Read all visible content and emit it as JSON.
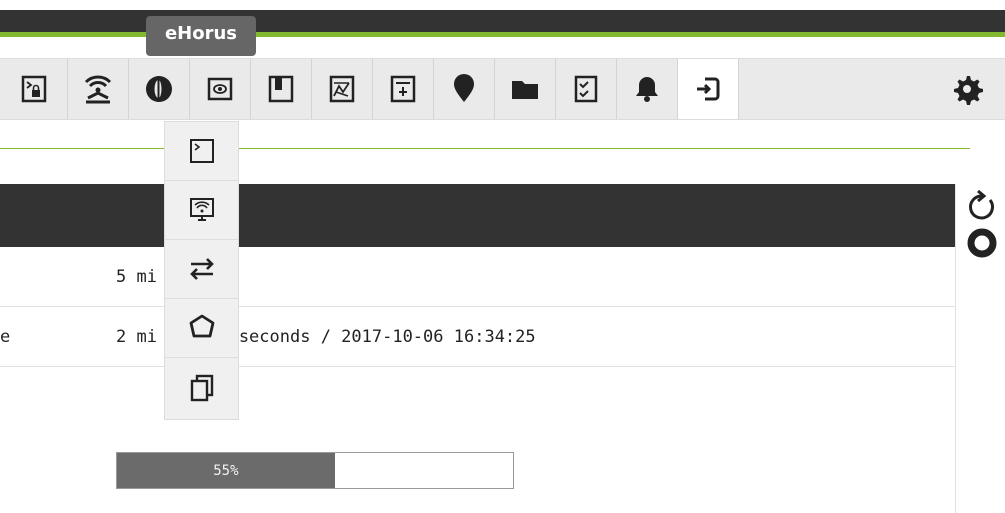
{
  "tooltip": {
    "text": "eHorus"
  },
  "toolbar": {
    "items": [
      {
        "name": "terminal-lock-icon"
      },
      {
        "name": "wireless-antenna-icon"
      },
      {
        "name": "ehorus-icon"
      },
      {
        "name": "eye-icon"
      },
      {
        "name": "bookmark-icon"
      },
      {
        "name": "network-graph-icon"
      },
      {
        "name": "report-icon"
      },
      {
        "name": "map-pin-icon"
      },
      {
        "name": "folder-icon"
      },
      {
        "name": "checklist-icon"
      },
      {
        "name": "bell-icon"
      },
      {
        "name": "login-icon",
        "active": true
      },
      {
        "name": "gear-icon"
      }
    ]
  },
  "dropdown": {
    "items": [
      {
        "name": "terminal-icon"
      },
      {
        "name": "remote-display-icon"
      },
      {
        "name": "transfer-arrows-icon"
      },
      {
        "name": "process-icon"
      },
      {
        "name": "copy-icon"
      }
    ]
  },
  "rows": [
    {
      "label": "",
      "value": "5 mi"
    },
    {
      "label": "e",
      "value": "2 mi ... 44 seconds / 2017-10-06 16:34:25"
    }
  ],
  "progress": {
    "value": 55,
    "label": "55%"
  },
  "side_icons": [
    "refresh-icon",
    "circle-icon"
  ],
  "colors": {
    "accent": "#82b92e",
    "dark": "#333333",
    "toolbar_bg": "#eaeaea"
  }
}
